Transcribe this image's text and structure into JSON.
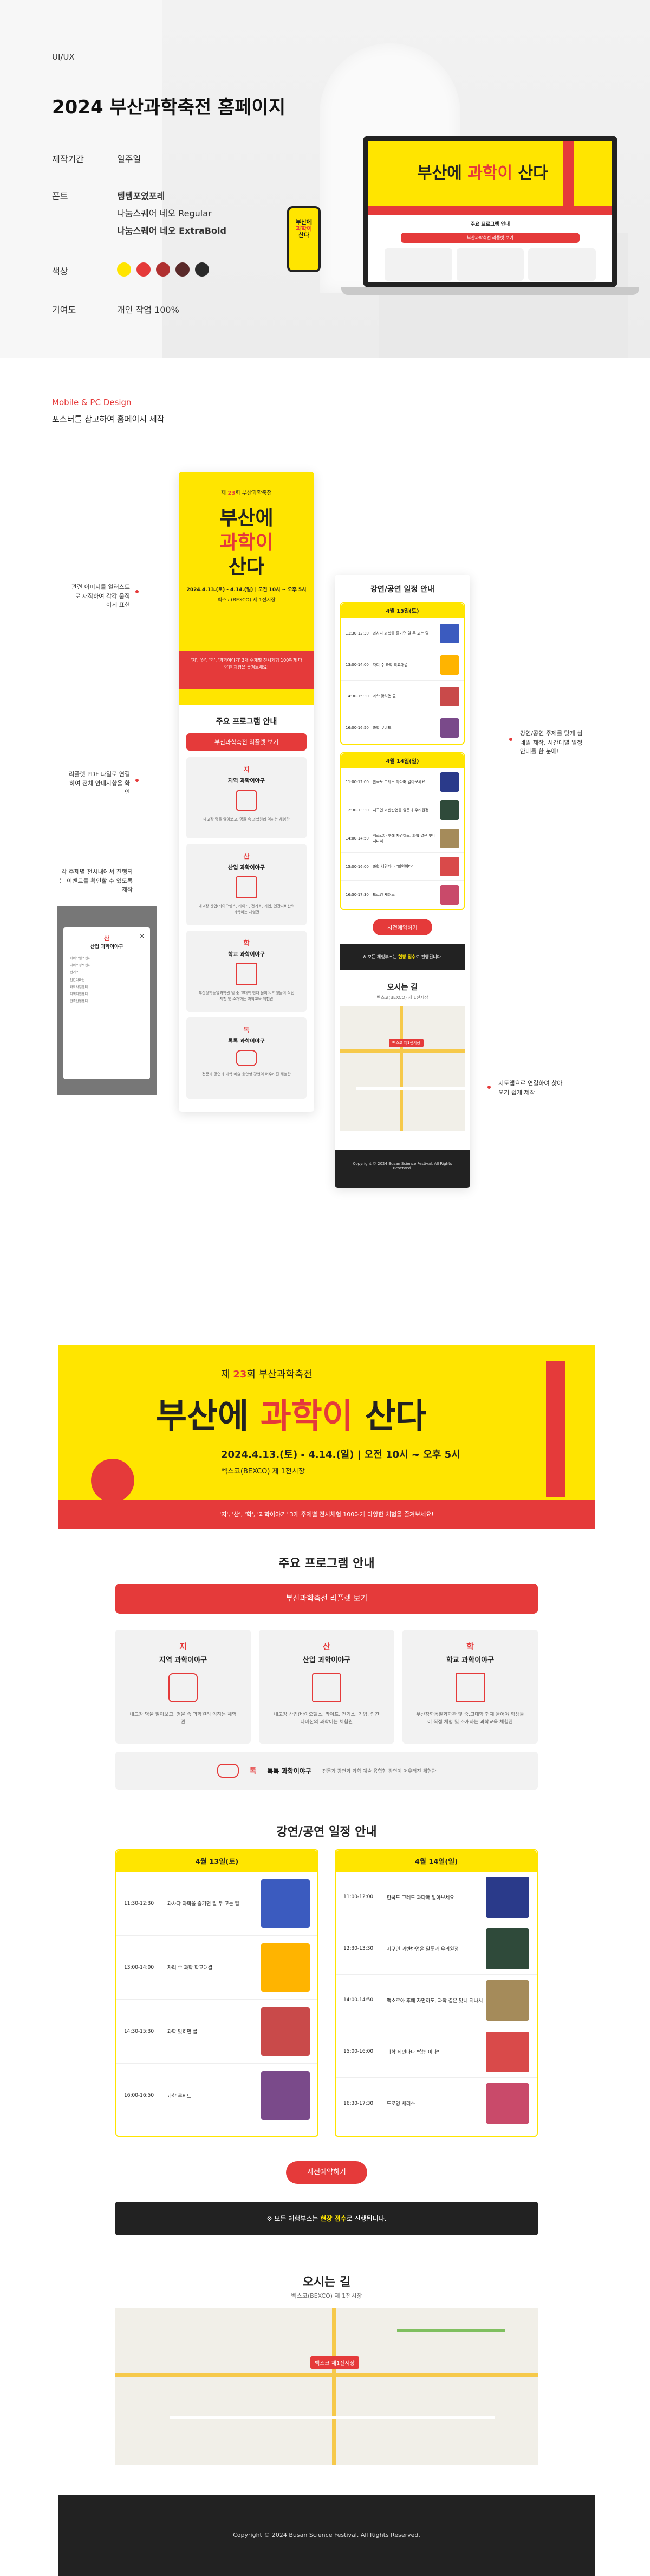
{
  "header": {
    "category": "UI/UX",
    "title": "2024 부산과학축전 홈페이지",
    "rows": [
      {
        "key": "제작기간",
        "value": "일주일"
      },
      {
        "key": "폰트",
        "values": [
          "텡텡포였포레",
          "나눔스퀘어 네오 Regular",
          "나눔스퀘어 네오 ExtraBold"
        ]
      },
      {
        "key": "색상",
        "colors": [
          "#ffe500",
          "#e53a3a",
          "#b03030",
          "#5a2a2a",
          "#2a2a2a"
        ]
      },
      {
        "key": "기여도",
        "value": "개인 작업 100%"
      }
    ]
  },
  "intro": {
    "label": "Mobile & PC Design",
    "desc": "포스터를 참고하여 홈페이지 제작"
  },
  "poster": {
    "edition_prefix": "제",
    "edition_num": "23",
    "edition_suffix": "회 부산과학축전",
    "main1": "부산에",
    "main2": "과학이",
    "main3": "산다",
    "date": "2024.4.13.(토) - 4.14.(일)  |  오전 10시 ~ 오후 5시",
    "venue": "벡스코(BEXCO) 제 1전시장",
    "notice": "'지', '산', '학', '과학이야기' 3개 주제별 전시체험 100여개 다양한 체험을 즐겨보세요!"
  },
  "program": {
    "title": "주요 프로그램 안내",
    "leaflet_btn": "부산과학축전 리플렛 보기",
    "cards": [
      {
        "tag": "지",
        "title": "지역 과학이야구",
        "desc": "내고장 명물 알아보고, 명물 속 과학원리 익히는 체험관"
      },
      {
        "tag": "산",
        "title": "산업 과학이야구",
        "desc": "내고장 산업(바이오헬스, 라이프, 전기소, 기업, 인간다바산의 과학이는 체험관"
      },
      {
        "tag": "학",
        "title": "학교 과학이야구",
        "desc": "부산장학동알과학관 및 중.고대학 현재 울어야 학생들이 직접 체험 및 소개하는 과학교육 체험관"
      },
      {
        "tag": "톡",
        "title": "톡톡 과학이야구",
        "desc": "전문가 강연과 과학 예술 융합형 강연이 어우러진 체험관"
      }
    ]
  },
  "schedule": {
    "title": "강연/공연 일정 안내",
    "day1": {
      "label": "4월 13일(토)",
      "items": [
        {
          "time": "11:30-12:30",
          "text": "과사다 과학을 즐기면 말 두 고는 말"
        },
        {
          "time": "13:00-14:00",
          "text": "자리 수 과학 학교대결"
        },
        {
          "time": "14:30-15:30",
          "text": "과학 맞히면 골"
        },
        {
          "time": "16:00-16:50",
          "text": "과학 쿠비드"
        }
      ]
    },
    "day2": {
      "label": "4월 14일(일)",
      "items": [
        {
          "time": "11:00-12:00",
          "text": "한국도 그레도 과다매 알아보세요"
        },
        {
          "time": "12:30-13:30",
          "text": "지구인 과반반업을 알듯과 우리원정"
        },
        {
          "time": "14:00-14:50",
          "text": "맥소르아 후에 자면하도, 과학 결은 맞니 지나서"
        },
        {
          "time": "15:00-16:00",
          "text": "과학 세민다나 \"합인이다\""
        },
        {
          "time": "16:30-17:30",
          "text": "드로잉 세러스"
        }
      ]
    },
    "reserve_btn": "사전예약하기",
    "notice_pre": "※ 모든 체험부스는 ",
    "notice_hl": "현장 접수",
    "notice_post": "로 진행됩니다."
  },
  "directions": {
    "title": "오시는 길",
    "address": "벡스코(BEXCO) 제 1전시장",
    "map_label": "벡스코 제1전시장"
  },
  "footer": {
    "copyright": "Copyright © 2024 Busan Science Festival. All Rights Reserved."
  },
  "annotations": [
    "관련 이미지를 일러스트로 재작하여 각각 움직이게 표현",
    "리플렛 PDF 파일로 연결하여 전체 안내사항을 확인",
    "각 주제별 전시내에서 진행되는 이벤트를 확인할 수 있도록 제작",
    "강연/공연 주제를 맞게 썸네일 제작, 시간대별 일정 안내를 한 눈에!",
    "지도앱으로 연결하여 찾아오기 쉽게 제작"
  ],
  "modal": {
    "tag": "산",
    "title": "산업 과학이야구",
    "rows": [
      "바이오헬스센터",
      "라이프정보센터",
      "전기소",
      "인간다바산",
      "과학사업센터",
      "지역지원센터",
      "관측산업센터"
    ]
  }
}
